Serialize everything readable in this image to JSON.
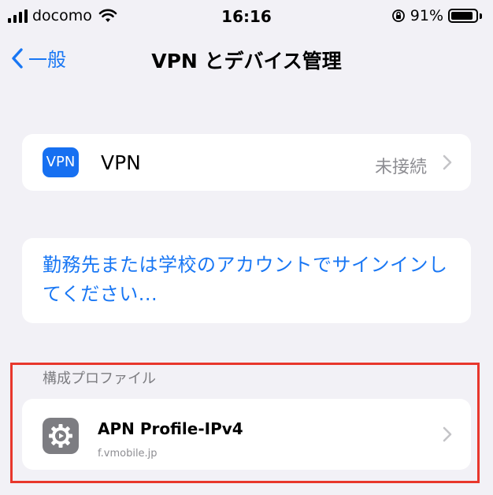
{
  "status_bar": {
    "carrier": "docomo",
    "time": "16:16",
    "battery": "91%",
    "battery_level": 0.91
  },
  "nav": {
    "back_label": "一般",
    "title": "VPN とデバイス管理"
  },
  "vpn": {
    "badge": "VPN",
    "label": "VPN",
    "status": "未接続"
  },
  "signin": {
    "label": "勤務先または学校のアカウントでサインインしてください..."
  },
  "profiles": {
    "header": "構成プロファイル",
    "items": [
      {
        "name": "APN Profile-IPv4",
        "subtitle": "f.vmobile.jp"
      }
    ]
  },
  "colors": {
    "accent": "#1977f4",
    "highlight": "#e8372c",
    "background": "#f2f1f6"
  }
}
